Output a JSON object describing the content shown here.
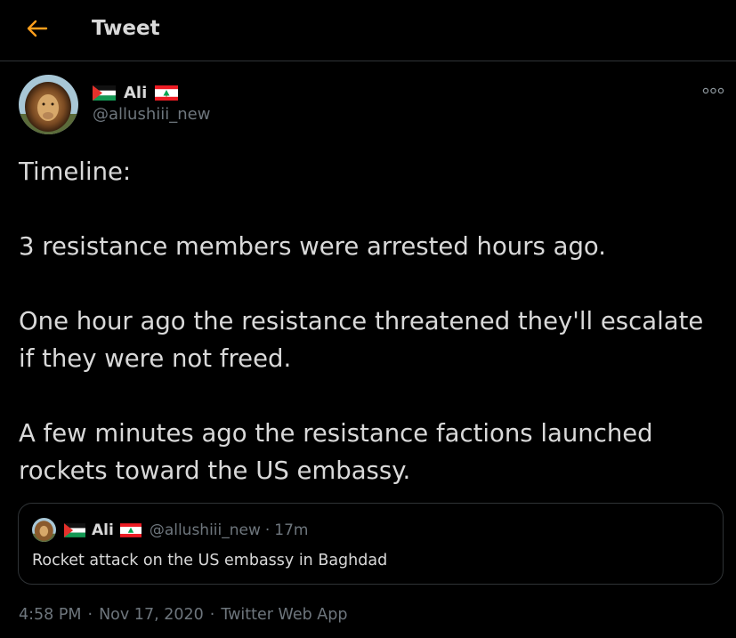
{
  "header": {
    "title": "Tweet",
    "back_icon": "arrow-left-icon",
    "accent": "#ff9f1c"
  },
  "author": {
    "name": "Ali",
    "handle": "@allushiii_new",
    "flag_left": "palestine-flag-icon",
    "flag_right": "lebanon-flag-icon"
  },
  "more_icon": "more-horizontal-icon",
  "tweet": {
    "lines": [
      "Timeline:",
      "",
      "3 resistance members were arrested hours ago.",
      "",
      "One hour ago the resistance threatened they'll escalate",
      "if they were not freed.",
      "",
      "A few minutes ago the resistance factions launched",
      "rockets toward the US embassy."
    ]
  },
  "quote": {
    "name": "Ali",
    "handle": "@allushiii_new",
    "separator": "·",
    "time": "17m",
    "text": "Rocket attack on the US embassy in Baghdad"
  },
  "meta": {
    "time": "4:58 PM",
    "date": "Nov 17, 2020",
    "source": "Twitter Web App",
    "separator": "·"
  },
  "colors": {
    "background": "#000000",
    "text": "#d9d9d9",
    "secondary": "#6e767d",
    "border": "#2f3336"
  }
}
